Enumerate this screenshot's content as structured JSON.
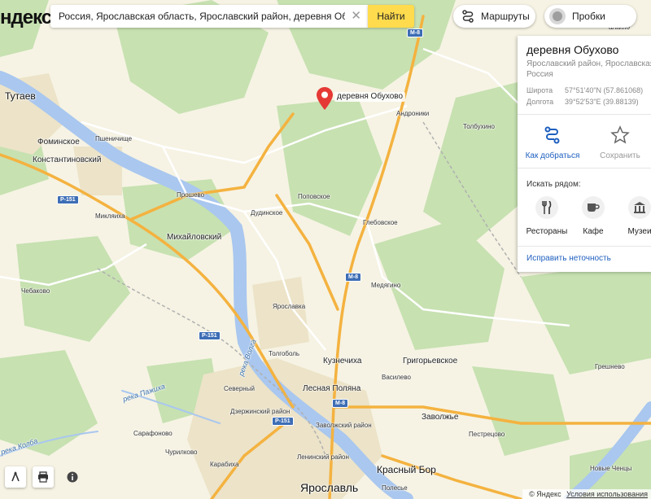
{
  "header": {
    "logo_text": "ндекс",
    "search_value": "Россия, Ярославская область, Ярославский район, деревня Обухово",
    "find_label": "Найти",
    "routes_label": "Маршруты",
    "traffic_label": "Пробки"
  },
  "marker": {
    "label": "деревня Обухово"
  },
  "panel": {
    "title": "деревня Обухово",
    "address": "Ярославский район, Ярославская Россия",
    "lat_label": "Широта",
    "lat_value": "57°51'40\"N (57.861068)",
    "lon_label": "Долгота",
    "lon_value": "39°52'53\"E (39.88139)",
    "directions_label": "Как добраться",
    "save_label": "Сохранить",
    "nearby_heading": "Искать рядом:",
    "categories": [
      "Рестораны",
      "Кафе",
      "Музеи"
    ],
    "fix_link": "Исправить неточность"
  },
  "map_labels": {
    "tutaev": "Тутаев",
    "fominskoe": "Фоминское",
    "pshenichishche": "Пшеничище",
    "konstantinovsky": "Константиновский",
    "proshevo": "Прошево",
    "miklyaikha": "Микляиха",
    "mikhaylovsky": "Михайловский",
    "dudinskoe": "Дудинское",
    "popovskoe": "Поповское",
    "glebovskoe": "Глебовское",
    "androniki": "Андроники",
    "tolbukhino": "Толбухино",
    "chebakovo": "Чебаково",
    "medyagino": "Медягино",
    "yaroslavka": "Ярославка",
    "tolgobol": "Толгоболь",
    "kuznechikha": "Кузнечиха",
    "grigorevskoe": "Григорьевское",
    "vasilevo": "Василево",
    "greshnevo": "Грешнево",
    "severny": "Северный",
    "dzerzhinsky": "Дзержинский район",
    "lesnaya_polyana": "Лесная Поляна",
    "zavolzhsky": "Заволжский район",
    "zavolzhye": "Заволжье",
    "pestretsovo": "Пестрецово",
    "sarafonovo": "Сарафоново",
    "churilkovo": "Чурилково",
    "karabikha": "Карабиха",
    "leninsky": "Ленинский район",
    "krasny_bor": "Красный Бор",
    "yaroslavl": "Ярославль",
    "polesye": "Полесье",
    "novye_chentsy": "Новые Ченцы",
    "volga_river": "река Волга",
    "pazhikha_river": "река Пажиха",
    "kolba_river": "река Колба",
    "top_partial": "алкино"
  },
  "road_shields": {
    "m8_a": "М-8",
    "m8_b": "М-8",
    "m8_c": "М-8",
    "p151_a": "Р-151",
    "p151_b": "Р-151",
    "p151_c": "Р-151"
  },
  "footer": {
    "copyright": "© Яндекс",
    "terms": "Условия использования"
  },
  "colors": {
    "land": "#f6f3e4",
    "forest": "#c7e1b1",
    "water": "#a9c7ef",
    "road_major": "#f4b23f",
    "road_minor": "#ffffff",
    "urban": "#ece3c8",
    "accent_yellow": "#ffdb4d",
    "link_blue": "#1e5fbf",
    "marker_red": "#e53935"
  },
  "icons": [
    "marker-pin-icon",
    "route-icon",
    "traffic-icon",
    "directions-icon",
    "star-icon",
    "fork-knife-icon",
    "cup-icon",
    "museum-icon",
    "ruler-icon",
    "print-icon",
    "info-icon",
    "clear-icon"
  ]
}
